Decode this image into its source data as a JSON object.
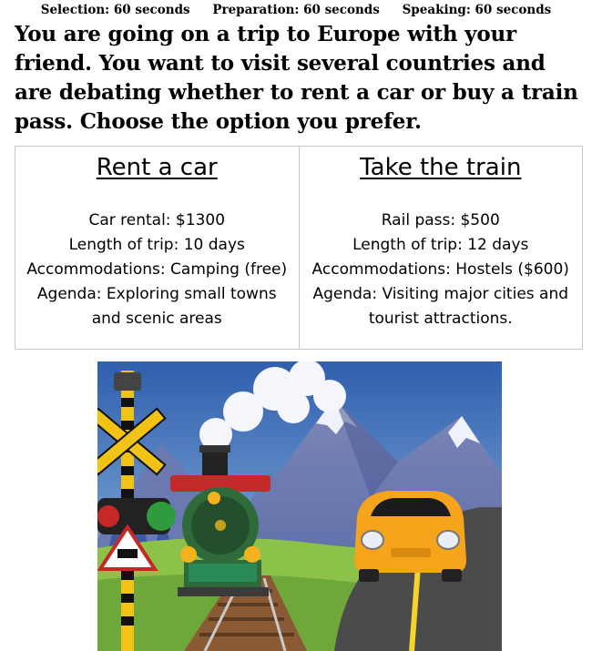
{
  "timers": {
    "selection": "Selection: 60 seconds",
    "preparation": "Preparation: 60 seconds",
    "speaking": "Speaking: 60 seconds"
  },
  "prompt": "You are going on a trip to Europe with your friend. You want to visit several countries and are debating whether to rent a car or buy a train pass. Choose the option you prefer.",
  "options": [
    {
      "title": "Rent a car",
      "lines": [
        "Car rental: $1300",
        "Length of trip: 10 days",
        "Accommodations: Camping (free)",
        "Agenda: Exploring small towns",
        "and scenic areas"
      ]
    },
    {
      "title": "Take the train",
      "lines": [
        "Rail pass: $500",
        "Length of trip: 12 days",
        "Accommodations: Hostels ($600)",
        "Agenda: Visiting major cities and",
        "tourist attractions."
      ]
    }
  ],
  "illustration": {
    "subjects": [
      "railroad-crossing-sign",
      "steam-train-icon",
      "yellow-car-icon",
      "mountains",
      "road",
      "railway-track"
    ],
    "colors": {
      "sky": "#3f6fb8",
      "mountain": "#6f7fb5",
      "grass": "#8cc24a",
      "road": "#4b4b4b",
      "car": "#f7a41d",
      "train": "#2f6b3a"
    }
  }
}
